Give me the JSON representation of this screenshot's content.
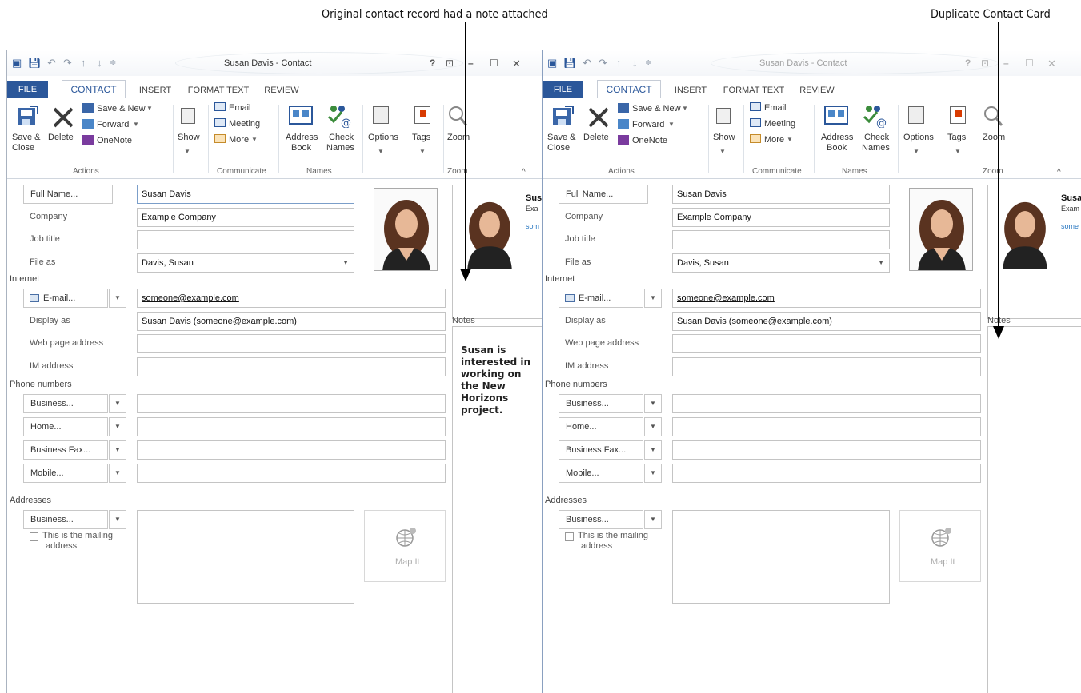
{
  "callouts": {
    "original": "Original contact record had a note attached",
    "duplicate": "Duplicate Contact Card"
  },
  "window": {
    "title": "Susan Davis - Contact",
    "help": "?",
    "tabs": {
      "file": "FILE",
      "contact": "CONTACT",
      "insert": "INSERT",
      "format_text": "FORMAT TEXT",
      "review": "REVIEW"
    },
    "ribbon": {
      "save_close": "Save &\nClose",
      "save_close_l1": "Save &",
      "save_close_l2": "Close",
      "delete": "Delete",
      "save_new": "Save & New",
      "forward": "Forward",
      "onenote": "OneNote",
      "actions": "Actions",
      "show": "Show",
      "email": "Email",
      "meeting": "Meeting",
      "more": "More",
      "communicate": "Communicate",
      "address_book_l1": "Address",
      "address_book_l2": "Book",
      "check_names_l1": "Check",
      "check_names_l2": "Names",
      "names": "Names",
      "options": "Options",
      "tags": "Tags",
      "zoom": "Zoom",
      "zoom_group": "Zoom"
    },
    "form": {
      "full_name_btn": "Full Name...",
      "full_name": "Susan Davis",
      "company_label": "Company",
      "company": "Example Company",
      "job_title_label": "Job title",
      "job_title": "",
      "file_as_label": "File as",
      "file_as": "Davis, Susan",
      "internet_header": "Internet",
      "email_btn": "E-mail...",
      "email": "someone@example.com",
      "display_as_label": "Display as",
      "display_as": "Susan Davis (someone@example.com)",
      "web_label": "Web page address",
      "im_label": "IM address",
      "phone_header": "Phone numbers",
      "business_btn": "Business...",
      "home_btn": "Home...",
      "business_fax_btn": "Business Fax...",
      "mobile_btn": "Mobile...",
      "addresses_header": "Addresses",
      "address_btn": "Business...",
      "mailing_l1": "This is the mailing",
      "mailing_l2": "address",
      "map_it": "Map It"
    },
    "card": {
      "name": "Sus",
      "company": "Exa",
      "email": "som"
    },
    "card2": {
      "name": "Susa",
      "company": "Exam",
      "email": "some"
    },
    "notes_label": "Notes",
    "notes_text": "Susan is interested in working on the New Horizons project."
  },
  "colors": {
    "accent": "#2b579a",
    "file_tab": "#2b579a"
  }
}
